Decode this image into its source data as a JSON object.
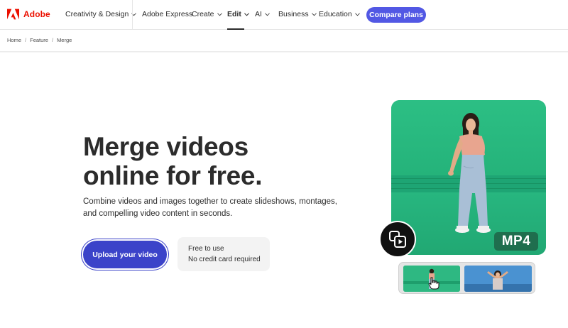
{
  "nav": {
    "brand": "Adobe",
    "items": [
      {
        "label": "Creativity & Design",
        "dropdown": true
      },
      {
        "label": "Adobe Express",
        "dropdown": false
      },
      {
        "label": "Create",
        "dropdown": true
      },
      {
        "label": "Edit",
        "dropdown": true,
        "active": true
      },
      {
        "label": "AI",
        "dropdown": true
      },
      {
        "label": "Business",
        "dropdown": true
      },
      {
        "label": "Education",
        "dropdown": true
      }
    ],
    "cta_label": "Compare plans"
  },
  "breadcrumb": [
    "Home",
    "Feature",
    "Merge"
  ],
  "hero": {
    "title_line1": "Merge videos",
    "title_line2": "online for free.",
    "subtitle": "Combine videos and images together to create slideshows, montages, and compelling video content in seconds.",
    "upload_label": "Upload your video",
    "free_line1": "Free to use",
    "free_line2": "No credit card required",
    "badge": "MP4"
  },
  "icons": {
    "brand": "adobe-logo-icon",
    "merge": "merge-clips-icon",
    "cursor": "hand-pointer-icon",
    "chevron": "chevron-down-icon"
  },
  "colors": {
    "brand_red": "#eb1000",
    "cta": "#5258e4",
    "upload": "#3b43c9",
    "green_screen": "#26b47c"
  }
}
